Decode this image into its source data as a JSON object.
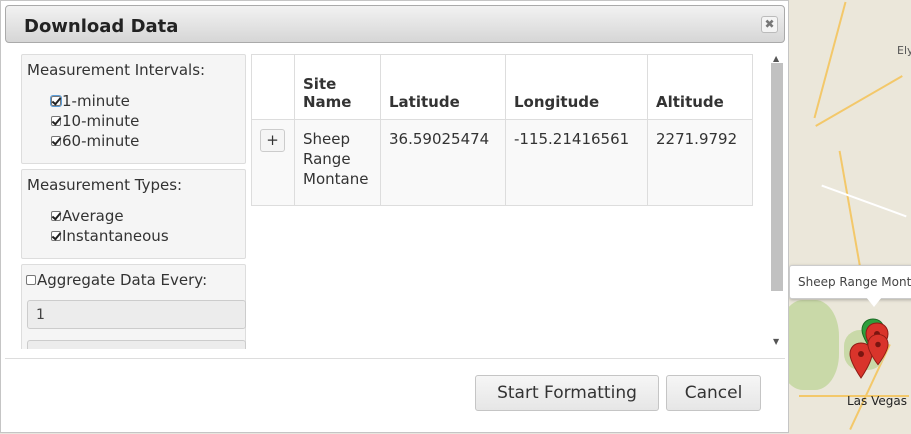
{
  "dialog": {
    "title": "Download Data",
    "close_glyph": "✖"
  },
  "intervals": {
    "title": "Measurement Intervals:",
    "options": [
      {
        "label": "1-minute",
        "checked": true
      },
      {
        "label": "10-minute",
        "checked": true
      },
      {
        "label": "60-minute",
        "checked": true
      }
    ]
  },
  "types": {
    "title": "Measurement Types:",
    "options": [
      {
        "label": "Average",
        "checked": true
      },
      {
        "label": "Instantaneous",
        "checked": true
      }
    ]
  },
  "aggregate": {
    "label": "Aggregate Data Every:",
    "checked": false,
    "value": "1"
  },
  "table": {
    "columns": [
      "",
      "Site Name",
      "Latitude",
      "Longitude",
      "Altitude"
    ],
    "rows": [
      {
        "expand": "+",
        "site_name": "Sheep Range Montane",
        "latitude": "36.59025474",
        "longitude": "-115.21416561",
        "altitude": "2271.9792"
      }
    ]
  },
  "buttons": {
    "start": "Start Formatting",
    "cancel": "Cancel"
  },
  "map": {
    "tooltip": "Sheep Range Montane",
    "places": [
      "Ely",
      "Las Vegas"
    ],
    "pin_color": "#d9342b"
  }
}
